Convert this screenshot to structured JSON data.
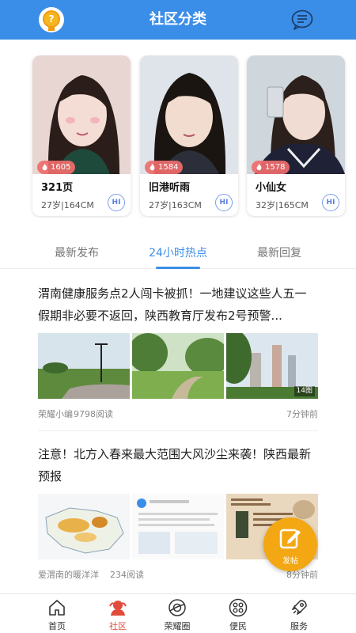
{
  "header": {
    "title": "社区分类",
    "badge_icon": "medal-icon",
    "message_icon": "chat-bubble-icon"
  },
  "profiles": [
    {
      "name": "321页",
      "likes": "1605",
      "meta": "27岁|164CM",
      "hi": "HI"
    },
    {
      "name": "旧港听雨",
      "likes": "1584",
      "meta": "27岁|163CM",
      "hi": "HI"
    },
    {
      "name": "小仙女",
      "likes": "1578",
      "meta": "32岁|165CM",
      "hi": "HI"
    }
  ],
  "tabs": {
    "items": [
      "最新发布",
      "24小时热点",
      "最新回复"
    ],
    "active_index": 1
  },
  "posts": [
    {
      "title": "渭南健康服务点2人闯卡被抓！一地建议这些人五一假期非必要不返回，陕西教育厅发布2号预警...",
      "author": "荣耀小编",
      "reads": "9798阅读",
      "time": "7分钟前",
      "image_count": "14图"
    },
    {
      "title": "注意！北方入春来最大范围大风沙尘来袭！陕西最新预报",
      "author": "爱渭南的暖洋洋",
      "reads": "234阅读",
      "time": "8分钟前"
    }
  ],
  "fab": {
    "label": "发帖"
  },
  "bottom_nav": [
    {
      "label": "首页",
      "icon": "home-icon"
    },
    {
      "label": "社区",
      "icon": "community-icon"
    },
    {
      "label": "荣耀圈",
      "icon": "planet-icon"
    },
    {
      "label": "便民",
      "icon": "grid-icon"
    },
    {
      "label": "服务",
      "icon": "rocket-icon"
    }
  ],
  "colors": {
    "primary": "#3b8ee8",
    "accent": "#f3a713",
    "active_nav": "#e24b3b",
    "likes_badge": "#f06c6c"
  }
}
